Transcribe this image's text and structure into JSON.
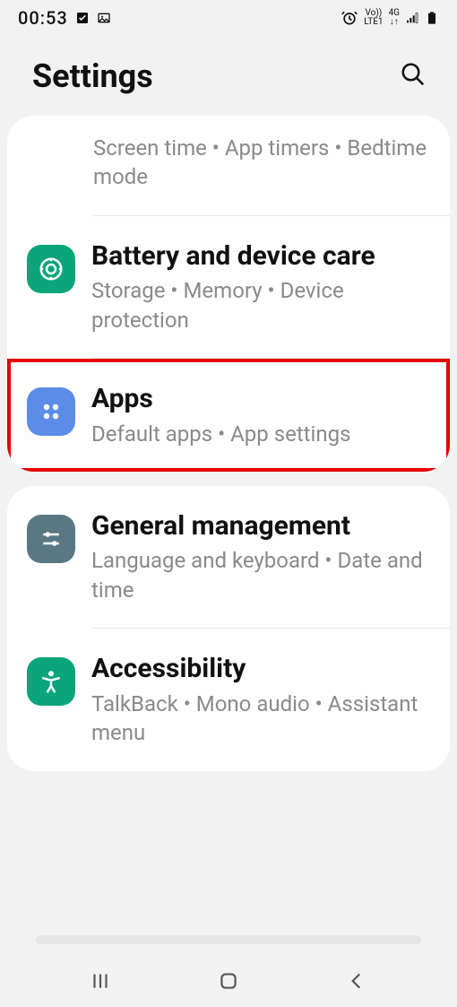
{
  "status": {
    "time": "00:53"
  },
  "header": {
    "title": "Settings"
  },
  "card1": {
    "item0": {
      "subtitle": "Screen time  •  App timers  •  Bedtime mode"
    },
    "item1": {
      "title": "Battery and device care",
      "subtitle": "Storage  •  Memory  •  Device protection",
      "icon_color": "#0aa57a"
    },
    "item2": {
      "title": "Apps",
      "subtitle": "Default apps  •  App settings",
      "icon_color": "#5b8de8",
      "highlighted": true
    }
  },
  "card2": {
    "item0": {
      "title": "General management",
      "subtitle": "Language and keyboard  •  Date and time",
      "icon_color": "#5a7884"
    },
    "item1": {
      "title": "Accessibility",
      "subtitle": "TalkBack  •  Mono audio  •  Assistant menu",
      "icon_color": "#0aa57a"
    }
  }
}
